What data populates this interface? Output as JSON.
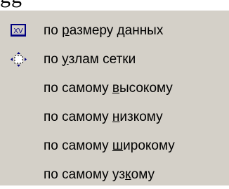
{
  "menu": {
    "items": [
      {
        "label": "по размеру данных",
        "before": "по ",
        "mnemonic": "р",
        "after": "азмеру данных",
        "icon": "data-size-icon"
      },
      {
        "label": "по узлам сетки",
        "before": "по ",
        "mnemonic": "у",
        "after": "злам сетки",
        "icon": "grid-nodes-icon"
      },
      {
        "label": "по самому высокому",
        "before": "по самому ",
        "mnemonic": "в",
        "after": "ысокому",
        "icon": ""
      },
      {
        "label": "по самому низкому",
        "before": "по самому ",
        "mnemonic": "н",
        "after": "изкому",
        "icon": ""
      },
      {
        "label": "по самому широкому",
        "before": "по самому ",
        "mnemonic": "ш",
        "after": "ирокому",
        "icon": ""
      },
      {
        "label": "по самому узкому",
        "before": "по самому ",
        "mnemonic": "к",
        "after": "ому",
        "prefix2": "уз",
        "icon": ""
      }
    ]
  },
  "colors": {
    "menu_background": "#d4d0c8",
    "icon_accent": "#000080"
  }
}
